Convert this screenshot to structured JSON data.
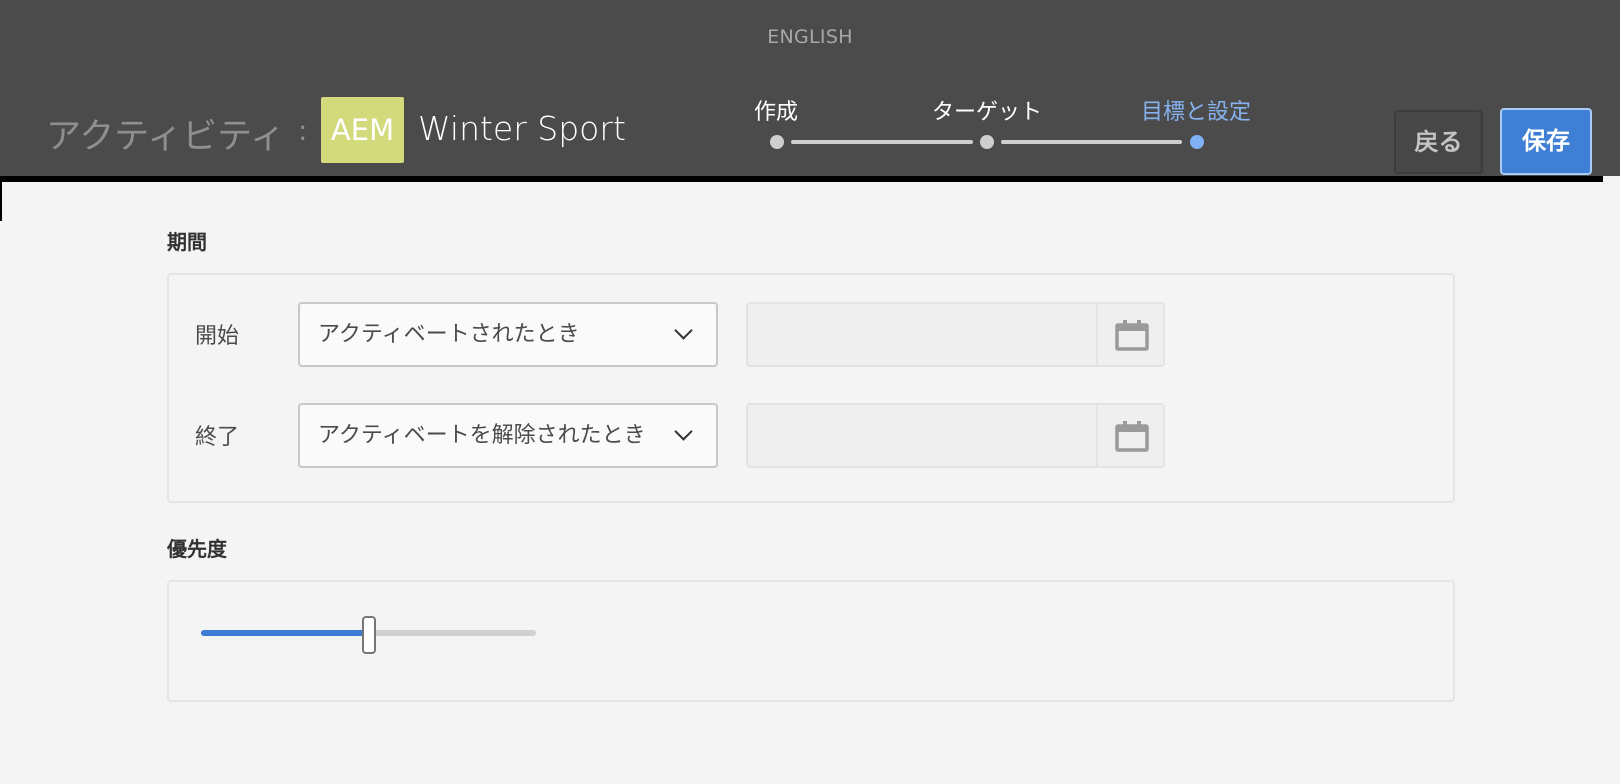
{
  "header": {
    "language": "ENGLISH",
    "activity_label": "アクティビティ",
    "activity_separator": ":",
    "badge": "AEM",
    "activity_name": "Winter Sport",
    "steps": [
      {
        "label": "作成",
        "active": false
      },
      {
        "label": "ターゲット",
        "active": false
      },
      {
        "label": "目標と設定",
        "active": true
      }
    ],
    "back_label": "戻る",
    "save_label": "保存"
  },
  "duration": {
    "title": "期間",
    "start": {
      "label": "開始",
      "selected": "アクティベートされたとき",
      "date_value": ""
    },
    "end": {
      "label": "終了",
      "selected": "アクティベートを解除されたとき",
      "date_value": ""
    }
  },
  "priority": {
    "title": "優先度",
    "level": 0.5
  },
  "colors": {
    "header_bg": "#4b4b4b",
    "accent": "#3f7fd6",
    "badge_bg": "#d2da7c",
    "active_step": "#86b3f0"
  },
  "icons": {
    "calendar": "calendar-icon",
    "dropdown": "chevron-down-icon"
  }
}
